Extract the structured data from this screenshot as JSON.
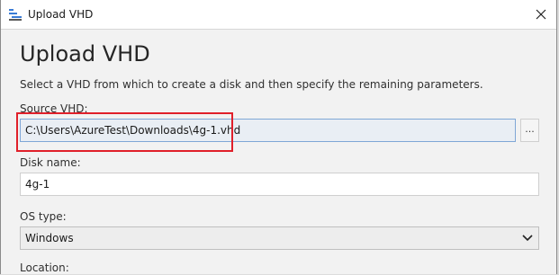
{
  "window": {
    "title": "Upload VHD",
    "icon": "upload-vhd-icon",
    "close_icon": "close-icon"
  },
  "page": {
    "heading": "Upload VHD",
    "description": "Select a VHD from which to create a disk and then specify the remaining parameters."
  },
  "source_vhd": {
    "label": "Source VHD:",
    "value": "C:\\Users\\AzureTest\\Downloads\\4g-1.vhd",
    "browse_label": "..."
  },
  "disk_name": {
    "label": "Disk name:",
    "value": "4g-1"
  },
  "os_type": {
    "label": "OS type:",
    "selected": "Windows"
  },
  "location": {
    "label": "Location:"
  },
  "colors": {
    "highlight": "#e0202a",
    "selected_field_border": "#7fa7d6"
  }
}
